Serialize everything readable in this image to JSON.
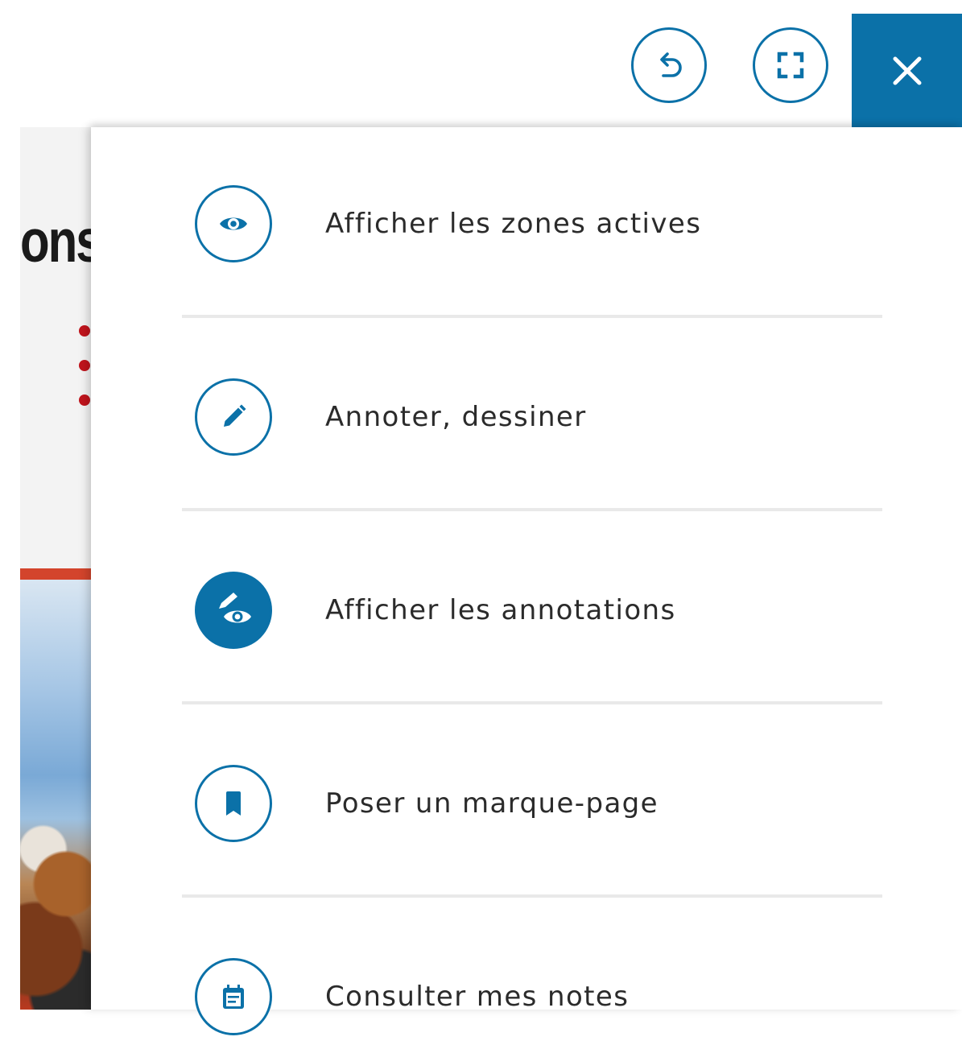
{
  "toolbar": {
    "undo_icon": "undo-icon",
    "fullscreen_icon": "fullscreen-icon",
    "close_icon": "close-icon"
  },
  "background_page": {
    "title_fragment": "ons"
  },
  "menu": {
    "items": [
      {
        "label": "Afficher les zones actives",
        "icon": "eye-icon"
      },
      {
        "label": "Annoter, dessiner",
        "icon": "pencil-icon"
      },
      {
        "label": "Afficher les annotations",
        "icon": "annotation-eye-icon",
        "active": true
      },
      {
        "label": "Poser un marque-page",
        "icon": "bookmark-icon"
      },
      {
        "label": "Consulter mes notes",
        "icon": "notes-icon"
      }
    ]
  },
  "colors": {
    "accent": "#0b71a8",
    "text": "#2b2b2b",
    "divider": "#e9e9e9"
  }
}
